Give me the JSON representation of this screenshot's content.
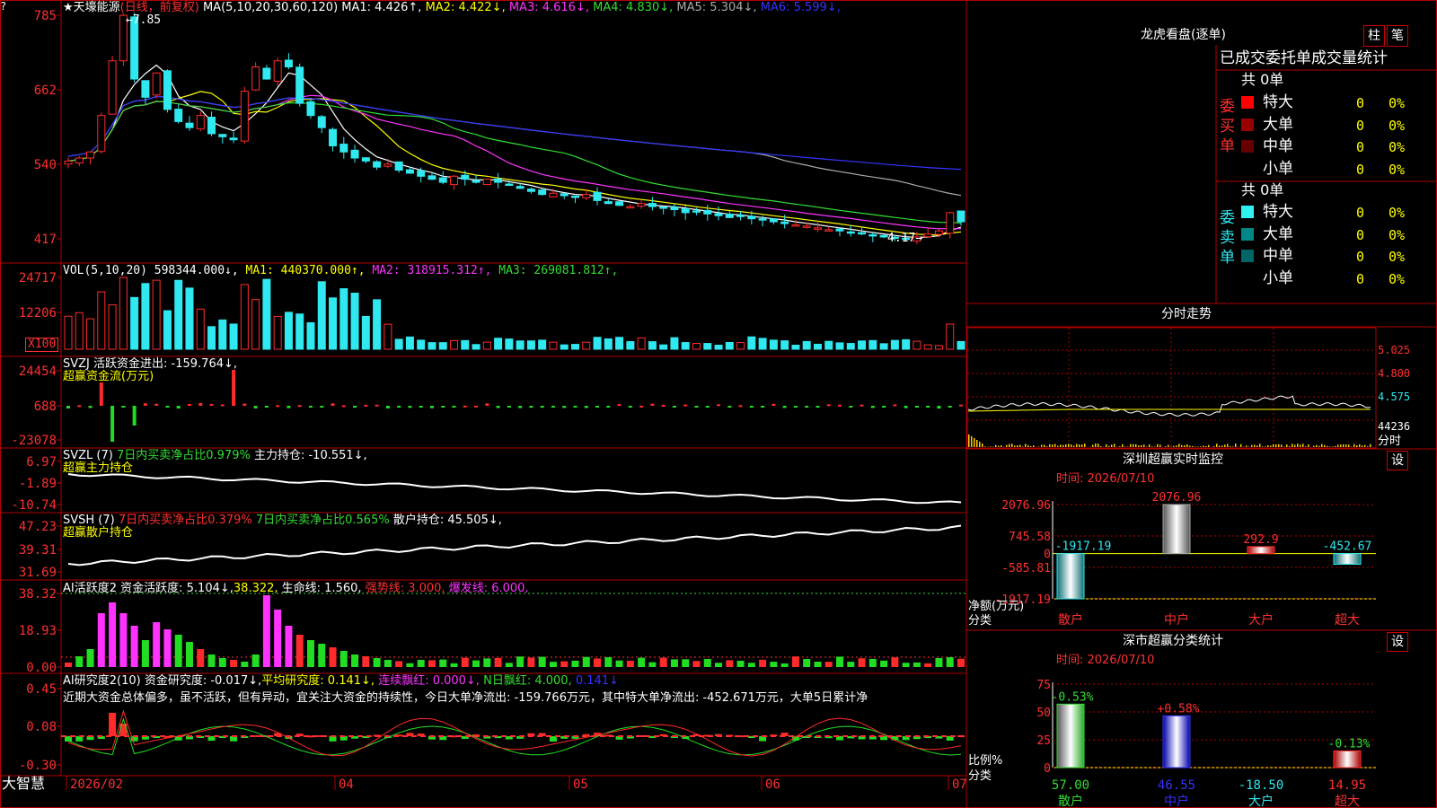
{
  "app": {
    "brand": "大智慧",
    "corner_mark": "?"
  },
  "colors": {
    "up": "#ff2a2a",
    "down": "#30e8f0",
    "grid": "#b00000",
    "ma1": "#ffffff",
    "ma2": "#ffff00",
    "ma3": "#ff33ff",
    "ma4": "#33dd33",
    "ma5": "#aaaaaa",
    "ma6": "#3333ff"
  },
  "kline": {
    "header": {
      "star": "★",
      "name": "天壕能源",
      "period": "(日线，前复权)",
      "ma_title": "MA(5,10,20,30,60,120)",
      "items": [
        {
          "label": "MA1:",
          "value": "4.426",
          "arrow": "↑",
          "color": "#ffffff"
        },
        {
          "label": "MA2:",
          "value": "4.422",
          "arrow": "↓",
          "color": "#ffff00"
        },
        {
          "label": "MA3:",
          "value": "4.616",
          "arrow": "↓",
          "color": "#ff33ff"
        },
        {
          "label": "MA4:",
          "value": "4.830",
          "arrow": "↓",
          "color": "#33dd33"
        },
        {
          "label": "MA5:",
          "value": "5.304",
          "arrow": "↓",
          "color": "#aaaaaa"
        },
        {
          "label": "MA6:",
          "value": "5.599",
          "arrow": "↓",
          "color": "#3333ff"
        }
      ]
    },
    "y_ticks": [
      "785",
      "662",
      "540",
      "417"
    ],
    "high_label": "7.85",
    "low_label": "4.17"
  },
  "volume": {
    "title": "VOL(5,10,20)",
    "items": [
      {
        "label": "",
        "value": "598344.000",
        "arrow": "↓",
        "color": "#ffffff"
      },
      {
        "label": "MA1:",
        "value": "440370.000",
        "arrow": "↑",
        "color": "#ffff00"
      },
      {
        "label": "MA2:",
        "value": "318915.312",
        "arrow": "↑",
        "color": "#ff33ff"
      },
      {
        "label": "MA3:",
        "value": "269081.812",
        "arrow": "↑",
        "color": "#33dd33"
      }
    ],
    "y_ticks": [
      "24717",
      "12206"
    ],
    "unit": "X100"
  },
  "svzj": {
    "title": "SVZJ",
    "line1": "活跃资金进出: -159.764↓,",
    "line2": "超赢资金流(万元)",
    "y_ticks": [
      "24454",
      "688",
      "-23078"
    ]
  },
  "svzl": {
    "title": "SVZL (7)",
    "text1": "7日内买卖净占比0.979%",
    "text2": "主力持仓: -10.551↓,",
    "line2": "超赢主力持仓",
    "y_ticks": [
      "6.97",
      "-1.89",
      "-10.74"
    ]
  },
  "svsh": {
    "title": "SVSH (7)",
    "text1": "7日内买卖净占比0.379%",
    "text2": "7日内买卖净占比0.565%",
    "text3": "散户持仓: 45.505↓,",
    "line2": "超赢散户持仓",
    "y_ticks": [
      "47.23",
      "39.31",
      "31.69"
    ]
  },
  "ai_active": {
    "title": "AI活跃度2",
    "text1": "资金活跃度: 5.104↓,",
    "text2": "38.322,",
    "text3": "生命线: 1.560,",
    "text4": "强势线: 3.000,",
    "text5": "爆发线: 6.000,",
    "y_ticks": [
      "38.32",
      "18.93",
      "0.00"
    ]
  },
  "ai_research": {
    "title": "AI研究度2(10)",
    "text1": "资金研究度: -0.017↓,",
    "text2": "平均研究度: 0.141↓,",
    "text3": "连续飘红: 0.000↓,",
    "text4": "N日飘红: 4.000,",
    "text5": "0.141↓",
    "comment": "近期大资金总体偏多，虽不活跃，但有异动，宜关注大资金的持续性，今日大单净流出: -159.766万元，其中特大单净流出: -452.671万元，大单5日累计净",
    "y_ticks": [
      "0.45",
      "0.08",
      "-0.30"
    ]
  },
  "x_axis": {
    "labels": [
      "2026/02",
      "04",
      "05",
      "06",
      "07"
    ]
  },
  "longhu": {
    "title": "龙虎看盘(逐单)",
    "buttons": [
      "柱",
      "笔"
    ],
    "subtitle": "已成交委托单成交量统计",
    "buy": {
      "label": "委买单",
      "total": "共 0单",
      "rows": [
        {
          "name": "特大",
          "count": "0",
          "pct": "0%",
          "color": "#ff0000"
        },
        {
          "name": "大单",
          "count": "0",
          "pct": "0%",
          "color": "#990000"
        },
        {
          "name": "中单",
          "count": "0",
          "pct": "0%",
          "color": "#660000"
        },
        {
          "name": "小单",
          "count": "0",
          "pct": "0%",
          "color": ""
        }
      ]
    },
    "sell": {
      "label": "委卖单",
      "total": "共 0单",
      "rows": [
        {
          "name": "特大",
          "count": "0",
          "pct": "0%",
          "color": "#30f0f0"
        },
        {
          "name": "大单",
          "count": "0",
          "pct": "0%",
          "color": "#008888"
        },
        {
          "name": "中单",
          "count": "0",
          "pct": "0%",
          "color": "#006666"
        },
        {
          "name": "小单",
          "count": "0",
          "pct": "0%",
          "color": ""
        }
      ]
    }
  },
  "intraday": {
    "title": "分时走势",
    "price_ticks": [
      "5.025",
      "4.800",
      "4.575"
    ],
    "vol_tick": "44236",
    "corner": "分时"
  },
  "monitor": {
    "title": "深圳超赢实时监控",
    "date_text": "时间: 2026/07/10",
    "setting": "设",
    "y_ticks": [
      "2076.96",
      "745.58",
      "0",
      "-585.81",
      "-1917.19"
    ],
    "ylabel": "净额(万元)",
    "xlabel": "分类",
    "chart_data": {
      "type": "bar",
      "categories": [
        "散户",
        "中户",
        "大户",
        "超大"
      ],
      "values": [
        -1917.19,
        2076.96,
        292.9,
        -452.67
      ],
      "value_labels": [
        "-1917.19",
        "2076.96",
        "292.9",
        "-452.67"
      ],
      "ylim": [
        -1917.19,
        2076.96
      ]
    }
  },
  "classify": {
    "title": "深市超赢分类统计",
    "date_text": "时间: 2026/07/10",
    "setting": "设",
    "y_ticks": [
      "75",
      "50",
      "25",
      "0"
    ],
    "ylabel": "比例%",
    "xlabel": "分类",
    "chart_data": {
      "type": "bar",
      "categories": [
        "散户",
        "中户",
        "大户",
        "超大"
      ],
      "values": [
        57.0,
        46.55,
        -18.5,
        14.95
      ],
      "value_labels": [
        "57.00",
        "46.55",
        "-18.50",
        "14.95"
      ],
      "change_labels": [
        "-0.53%",
        "+0.58%",
        "",
        "-0.13%"
      ],
      "ylim": [
        0,
        75
      ]
    }
  }
}
